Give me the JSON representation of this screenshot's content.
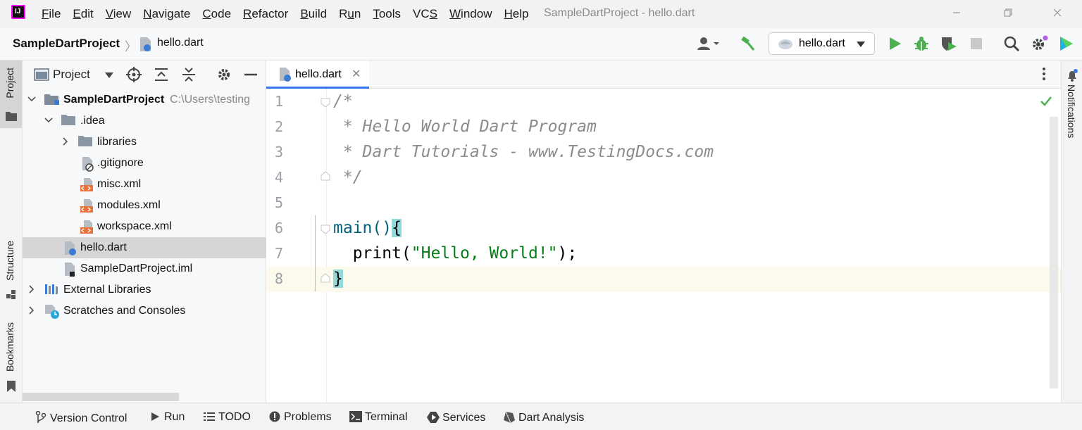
{
  "menu": {
    "items": [
      {
        "pre": "",
        "u": "F",
        "post": "ile"
      },
      {
        "pre": "",
        "u": "E",
        "post": "dit"
      },
      {
        "pre": "",
        "u": "V",
        "post": "iew"
      },
      {
        "pre": "",
        "u": "N",
        "post": "avigate"
      },
      {
        "pre": "",
        "u": "C",
        "post": "ode"
      },
      {
        "pre": "",
        "u": "R",
        "post": "efactor"
      },
      {
        "pre": "",
        "u": "B",
        "post": "uild"
      },
      {
        "pre": "R",
        "u": "u",
        "post": "n"
      },
      {
        "pre": "",
        "u": "T",
        "post": "ools"
      },
      {
        "pre": "VC",
        "u": "S",
        "post": ""
      },
      {
        "pre": "",
        "u": "W",
        "post": "indow"
      },
      {
        "pre": "",
        "u": "H",
        "post": "elp"
      }
    ]
  },
  "window_title": "SampleDartProject - hello.dart",
  "navbar": {
    "project": "SampleDartProject",
    "separator": "〉",
    "file": "hello.dart",
    "run_config": "hello.dart"
  },
  "left_stripe": {
    "project_tab": "Project",
    "structure_tab": "Structure",
    "bookmarks_tab": "Bookmarks"
  },
  "project_panel": {
    "title": "Project",
    "tree": [
      {
        "label": "SampleDartProject",
        "hint": "C:\\Users\\testing",
        "bold": true,
        "icon": "module-folder-icon",
        "chevron": "down"
      },
      {
        "label": ".idea",
        "icon": "folder-icon",
        "chevron": "down"
      },
      {
        "label": "libraries",
        "icon": "folder-icon",
        "chevron": "right"
      },
      {
        "label": ".gitignore",
        "icon": "ignored-file-icon",
        "chevron": ""
      },
      {
        "label": "misc.xml",
        "icon": "xml-file-icon",
        "chevron": ""
      },
      {
        "label": "modules.xml",
        "icon": "xml-file-icon",
        "chevron": ""
      },
      {
        "label": "workspace.xml",
        "icon": "xml-file-icon",
        "chevron": ""
      },
      {
        "label": "hello.dart",
        "icon": "dart-file-icon",
        "chevron": "",
        "selected": true
      },
      {
        "label": "SampleDartProject.iml",
        "icon": "iml-file-icon",
        "chevron": ""
      },
      {
        "label": "External Libraries",
        "icon": "libraries-icon",
        "chevron": "right"
      },
      {
        "label": "Scratches and Consoles",
        "icon": "scratches-icon",
        "chevron": "right"
      }
    ]
  },
  "editor": {
    "tab_label": "hello.dart",
    "tab_close": "✕",
    "line_numbers": [
      "1",
      "2",
      "3",
      "4",
      "5",
      "6",
      "7",
      "8"
    ],
    "code": {
      "l1": "/*",
      "l2": " * Hello World Dart Program",
      "l3": " * Dart Tutorials - www.TestingDocs.com",
      "l4": " */",
      "l6_fn": "main()",
      "l6_brace": "{",
      "l7_pre": "  print(",
      "l7_str": "\"Hello, World!\"",
      "l7_post": ");",
      "l8_brace": "}"
    }
  },
  "right_stripe": {
    "notifications": "Notifications"
  },
  "bottom_bar": {
    "items": [
      {
        "label": "Version Control",
        "icon": "version-control-icon"
      },
      {
        "label": "Run",
        "icon": "run-icon"
      },
      {
        "label": "TODO",
        "icon": "todo-icon"
      },
      {
        "label": "Problems",
        "icon": "problems-icon"
      },
      {
        "label": "Terminal",
        "icon": "terminal-icon"
      },
      {
        "label": "Services",
        "icon": "services-icon"
      },
      {
        "label": "Dart Analysis",
        "icon": "dart-analysis-icon"
      }
    ]
  },
  "colors": {
    "accent": "#3574f0",
    "run_green": "#4caf50",
    "comment": "#8c8c8c",
    "string": "#067d17",
    "function": "#00627a",
    "brace_highlight": "#93d9d9",
    "current_line": "#fcfaed"
  }
}
